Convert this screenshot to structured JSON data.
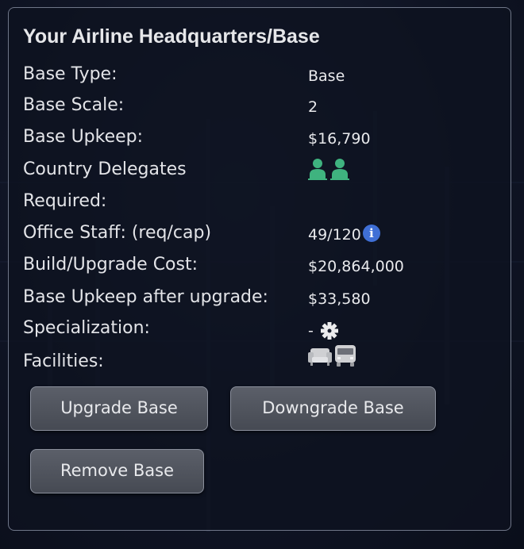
{
  "panel": {
    "title": "Your Airline Headquarters/Base",
    "rows": [
      {
        "label": "Base Type:",
        "value": "Base"
      },
      {
        "label": "Base Scale:",
        "value": "2"
      },
      {
        "label": "Base Upkeep:",
        "value": "$16,790"
      },
      {
        "label": "Country Delegates",
        "label2": "Required:",
        "delegate_count": 2,
        "delegate_color": "#3fb37f"
      },
      {
        "label": "Office Staff: (req/cap)",
        "value": "49/120",
        "icon": "info-icon"
      },
      {
        "label": "Build/Upgrade Cost:",
        "value": "$20,864,000"
      },
      {
        "label": "Base Upkeep after upgrade:",
        "value": "$33,580"
      },
      {
        "label": "Specialization:",
        "value": "-",
        "icon": "gear-icon"
      },
      {
        "label": "Facilities:",
        "icons": [
          "lounge-armchair-icon",
          "shuttle-bus-icon"
        ]
      }
    ]
  },
  "buttons": {
    "upgrade": "Upgrade Base",
    "downgrade": "Downgrade Base",
    "remove": "Remove Base"
  },
  "icons": {
    "info_glyph": "i"
  },
  "colors": {
    "info_blue": "#3f6fd6",
    "delegate_green": "#3fb37f",
    "button_bg": "#4f535c",
    "panel_border": "#6f7688"
  }
}
